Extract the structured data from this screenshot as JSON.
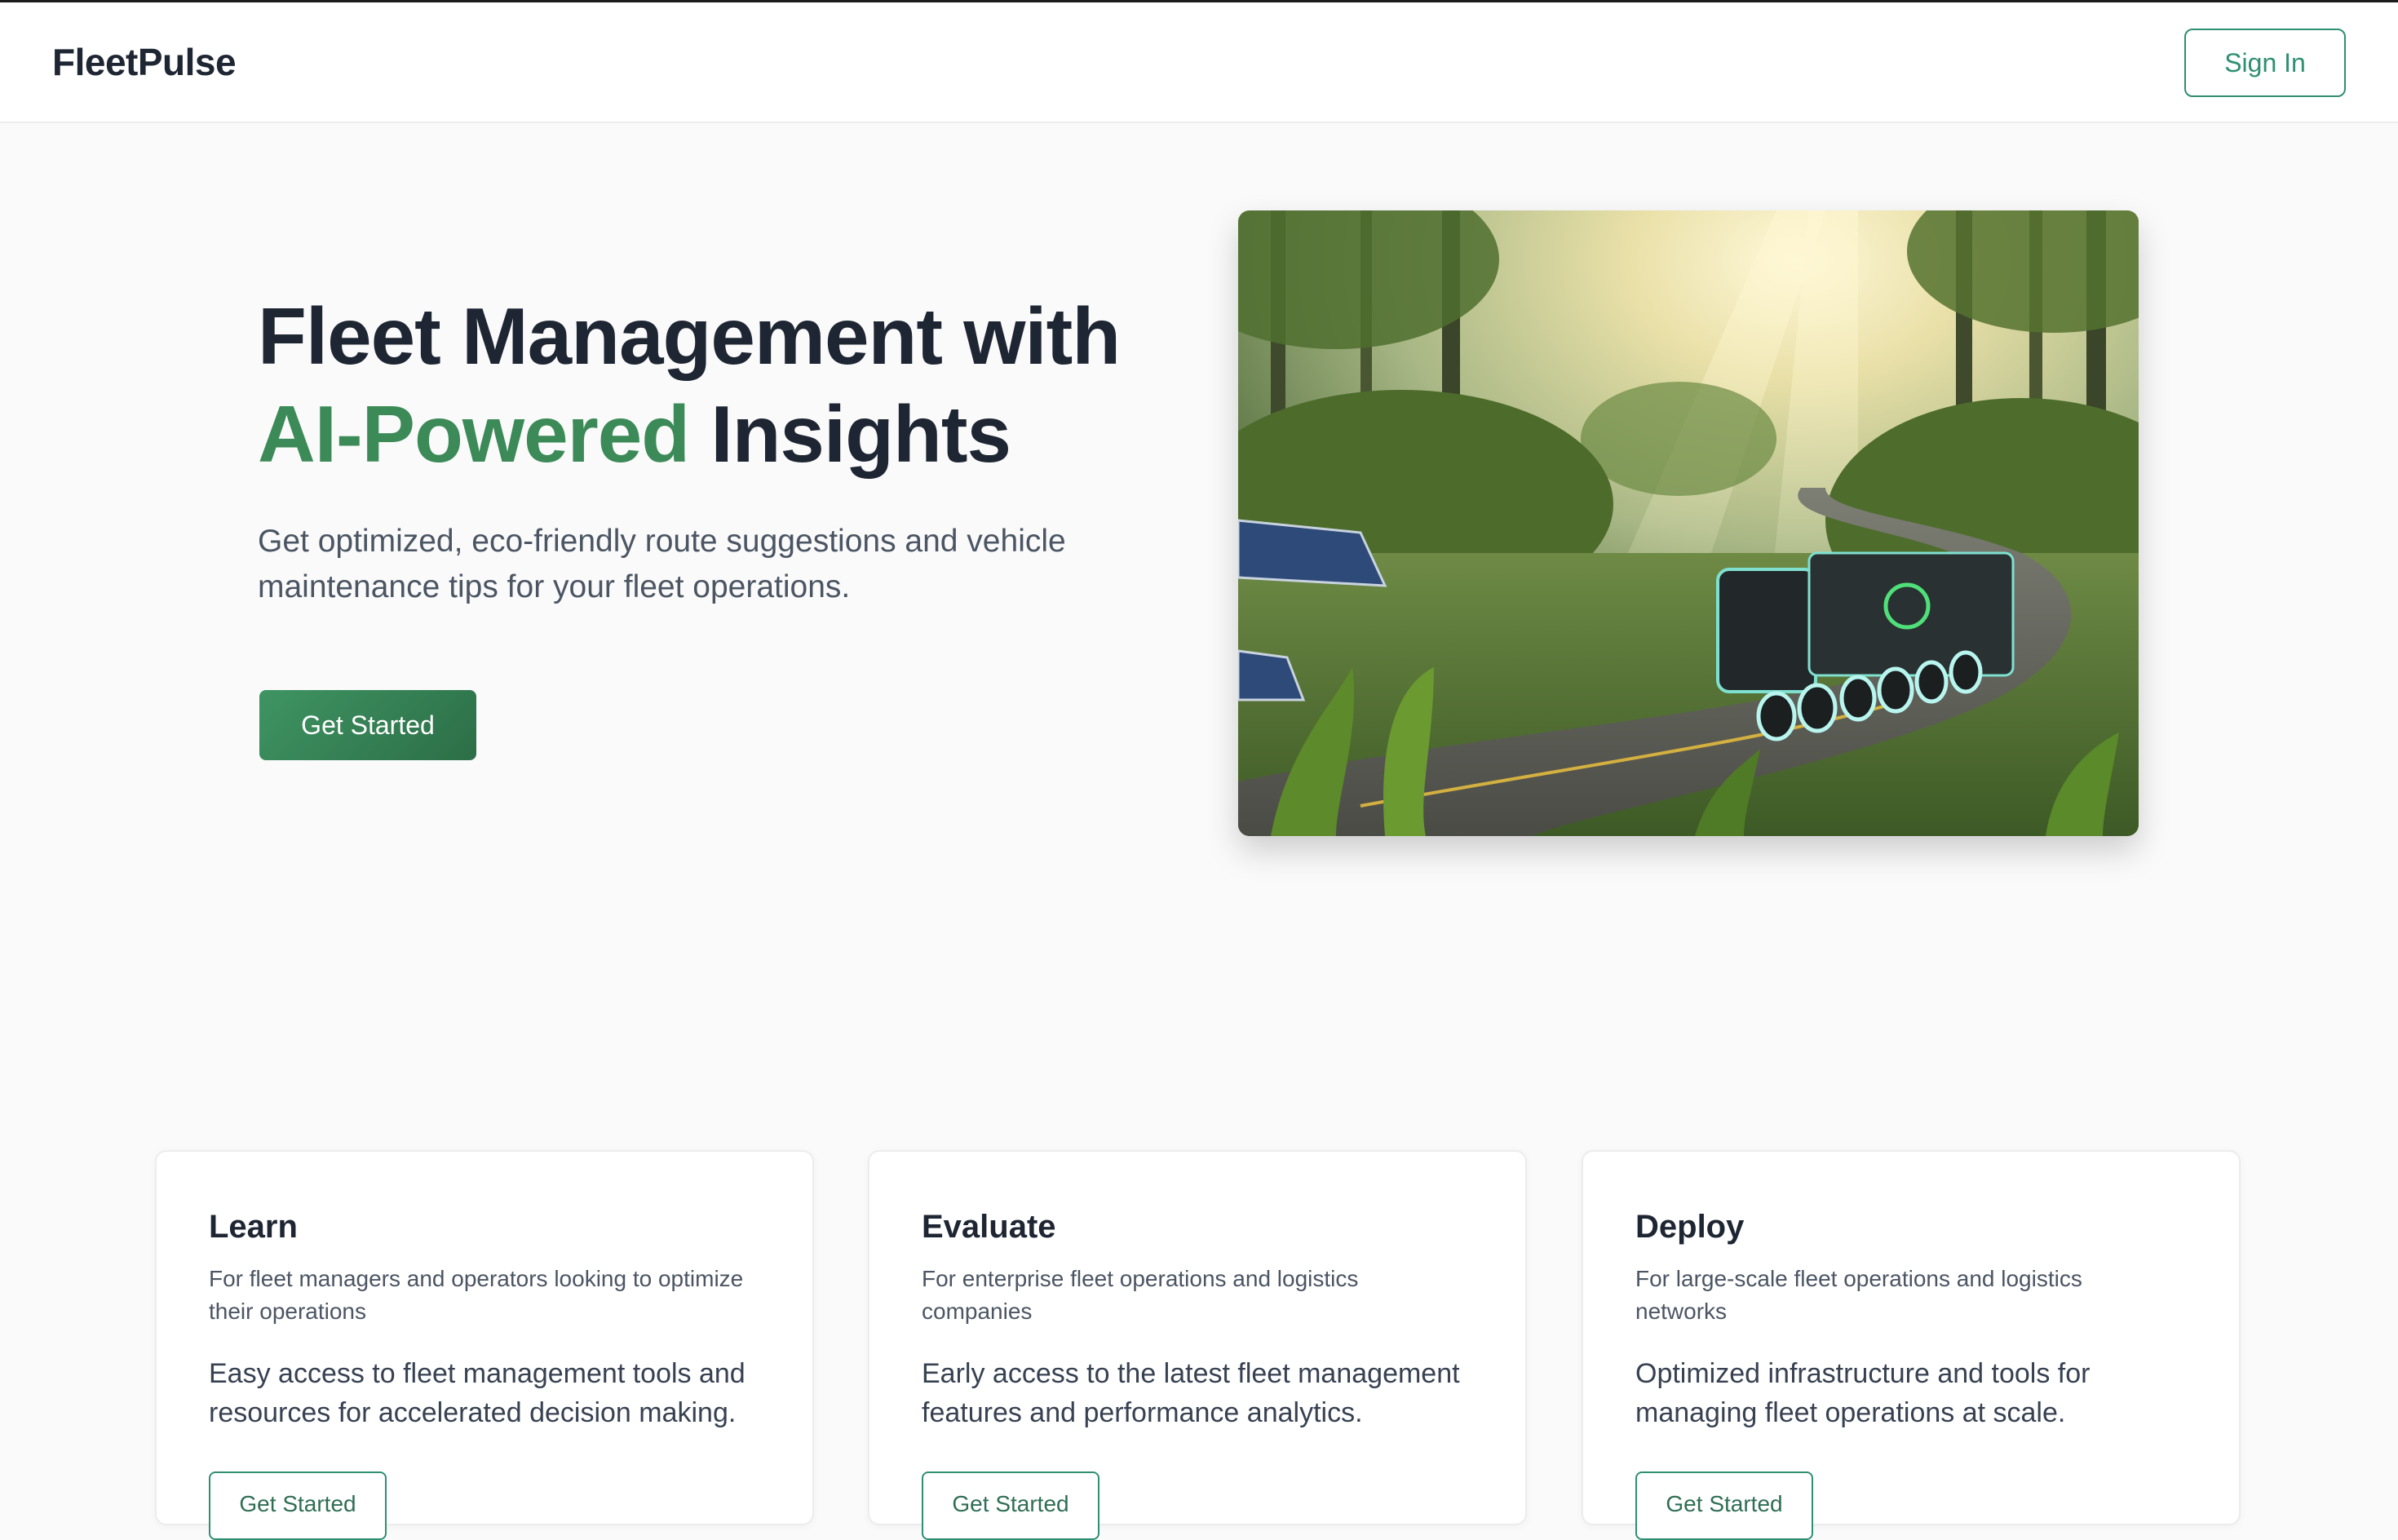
{
  "header": {
    "brand": "FleetPulse",
    "sign_in_label": "Sign In"
  },
  "hero": {
    "title_line1": "Fleet Management with",
    "title_accent": "AI-Powered",
    "title_rest": " Insights",
    "subtitle": "Get optimized, eco-friendly route suggestions and vehicle maintenance tips for your fleet operations.",
    "cta_label": "Get Started"
  },
  "colors": {
    "accent_green": "#3b8a57",
    "button_outline": "#2f8f72",
    "text_dark": "#1f2633"
  },
  "cards": [
    {
      "title": "Learn",
      "audience": "For fleet managers and operators looking to optimize their operations",
      "description": "Easy access to fleet management tools and resources for accelerated decision making.",
      "button_label": "Get Started"
    },
    {
      "title": "Evaluate",
      "audience": "For enterprise fleet operations and logistics companies",
      "description": "Early access to the latest fleet management features and performance analytics.",
      "button_label": "Get Started"
    },
    {
      "title": "Deploy",
      "audience": "For large-scale fleet operations and logistics networks",
      "description": "Optimized infrastructure and tools for managing fleet operations at scale.",
      "button_label": "Get Started"
    }
  ]
}
